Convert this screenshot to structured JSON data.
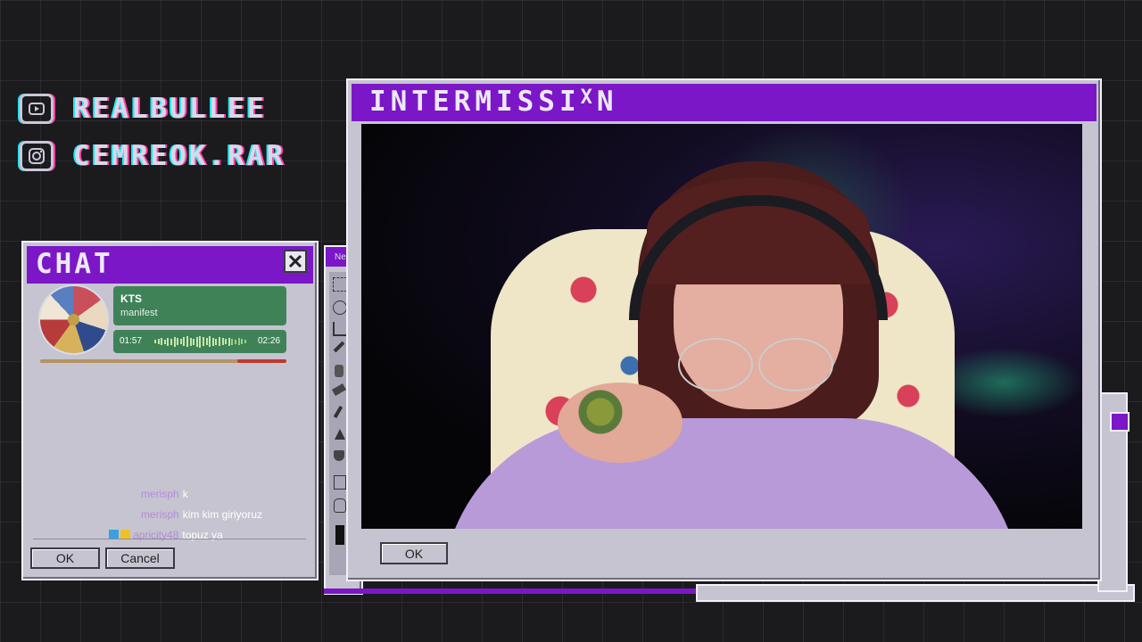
{
  "socials": [
    {
      "platform_icon": "youtube-icon",
      "handle": "REALBULLEE"
    },
    {
      "platform_icon": "instagram-icon",
      "handle": "CEMREOK.RAR"
    }
  ],
  "chat_window": {
    "title": "CHAT",
    "close_icon": "close-icon",
    "now_playing": {
      "artist": "KTS",
      "track": "manifest",
      "elapsed": "01:57",
      "duration": "02:26",
      "progress": 0.8
    },
    "messages": [
      {
        "user": "merisph",
        "text": "k"
      },
      {
        "user": "merisph",
        "text": "kim kim giriyoruz"
      },
      {
        "user": "apricity48",
        "text": "topuz ya",
        "badges": [
          "badge-icon",
          "bits-badge-icon"
        ]
      }
    ],
    "ok_label": "OK",
    "cancel_label": "Cancel"
  },
  "paint_window": {
    "title": "Ne",
    "tools": [
      "select-icon",
      "lasso-icon",
      "crop-icon",
      "pencil-icon",
      "brush-icon",
      "eraser-icon",
      "dropper-icon",
      "pointer-icon",
      "fill-icon",
      "text-icon",
      "hand-icon"
    ]
  },
  "main_window": {
    "title": "INTERMISSI",
    "title_glyph": "X",
    "title_tail": "N",
    "ok_label": "OK"
  },
  "colors": {
    "accent_purple": "#7b17c7",
    "window_gray": "#c5c4d0",
    "song_card_green": "#3f8258",
    "progress_red": "#c0392b"
  }
}
